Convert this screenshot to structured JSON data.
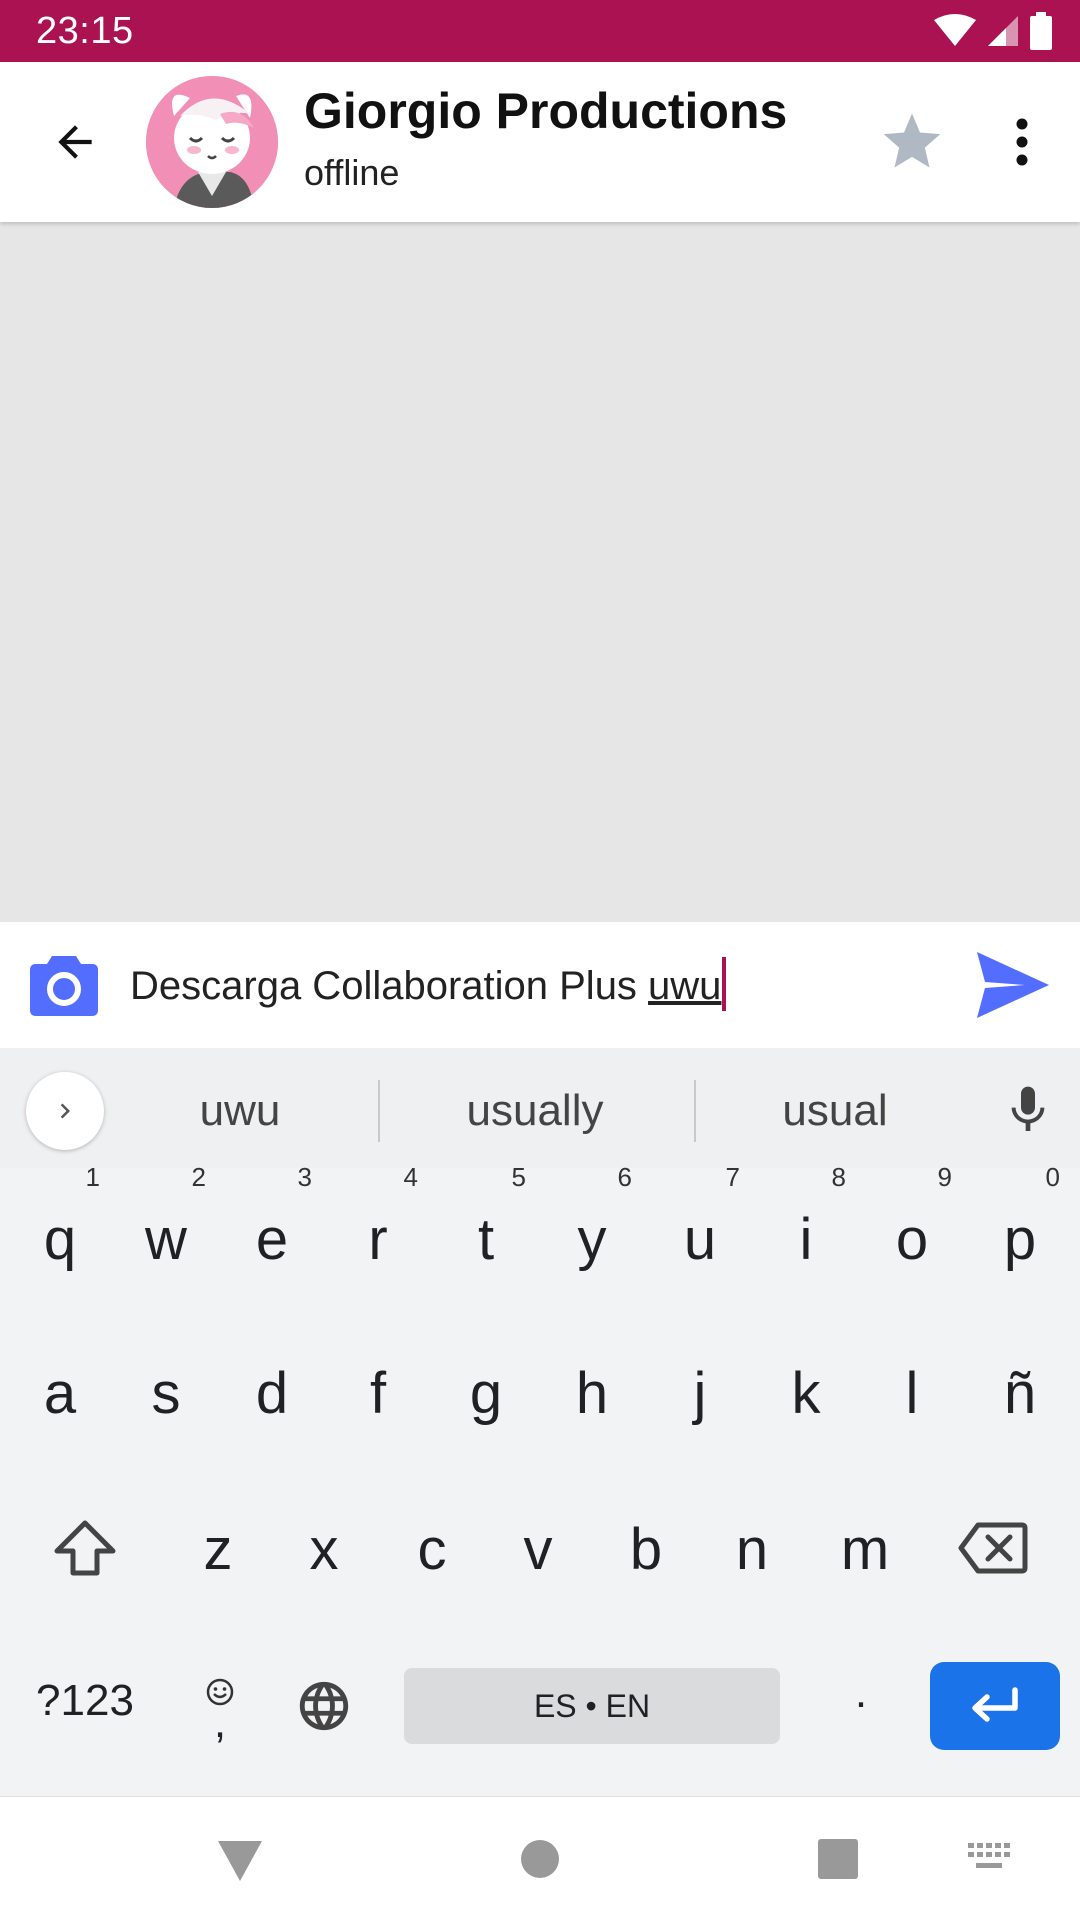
{
  "status_bar": {
    "time": "23:15"
  },
  "header": {
    "title": "Giorgio Productions",
    "subtitle": "offline"
  },
  "composer": {
    "text_before": "Descarga Collaboration Plus ",
    "text_current_word": "uwu"
  },
  "keyboard": {
    "suggestions": [
      "uwu",
      "usually",
      "usual"
    ],
    "row1": [
      {
        "key": "q",
        "hint": "1"
      },
      {
        "key": "w",
        "hint": "2"
      },
      {
        "key": "e",
        "hint": "3"
      },
      {
        "key": "r",
        "hint": "4"
      },
      {
        "key": "t",
        "hint": "5"
      },
      {
        "key": "y",
        "hint": "6"
      },
      {
        "key": "u",
        "hint": "7"
      },
      {
        "key": "i",
        "hint": "8"
      },
      {
        "key": "o",
        "hint": "9"
      },
      {
        "key": "p",
        "hint": "0"
      }
    ],
    "row2": [
      "a",
      "s",
      "d",
      "f",
      "g",
      "h",
      "j",
      "k",
      "l",
      "ñ"
    ],
    "row3": [
      "z",
      "x",
      "c",
      "v",
      "b",
      "n",
      "m"
    ],
    "symbols_label": "?123",
    "comma_label": ",",
    "space_label": "ES • EN",
    "period_label": "."
  },
  "colors": {
    "status_bar": "#ab1252",
    "accent_blue": "#536dfe",
    "enter_key": "#1a73e8",
    "star": "#b0b8c4"
  }
}
